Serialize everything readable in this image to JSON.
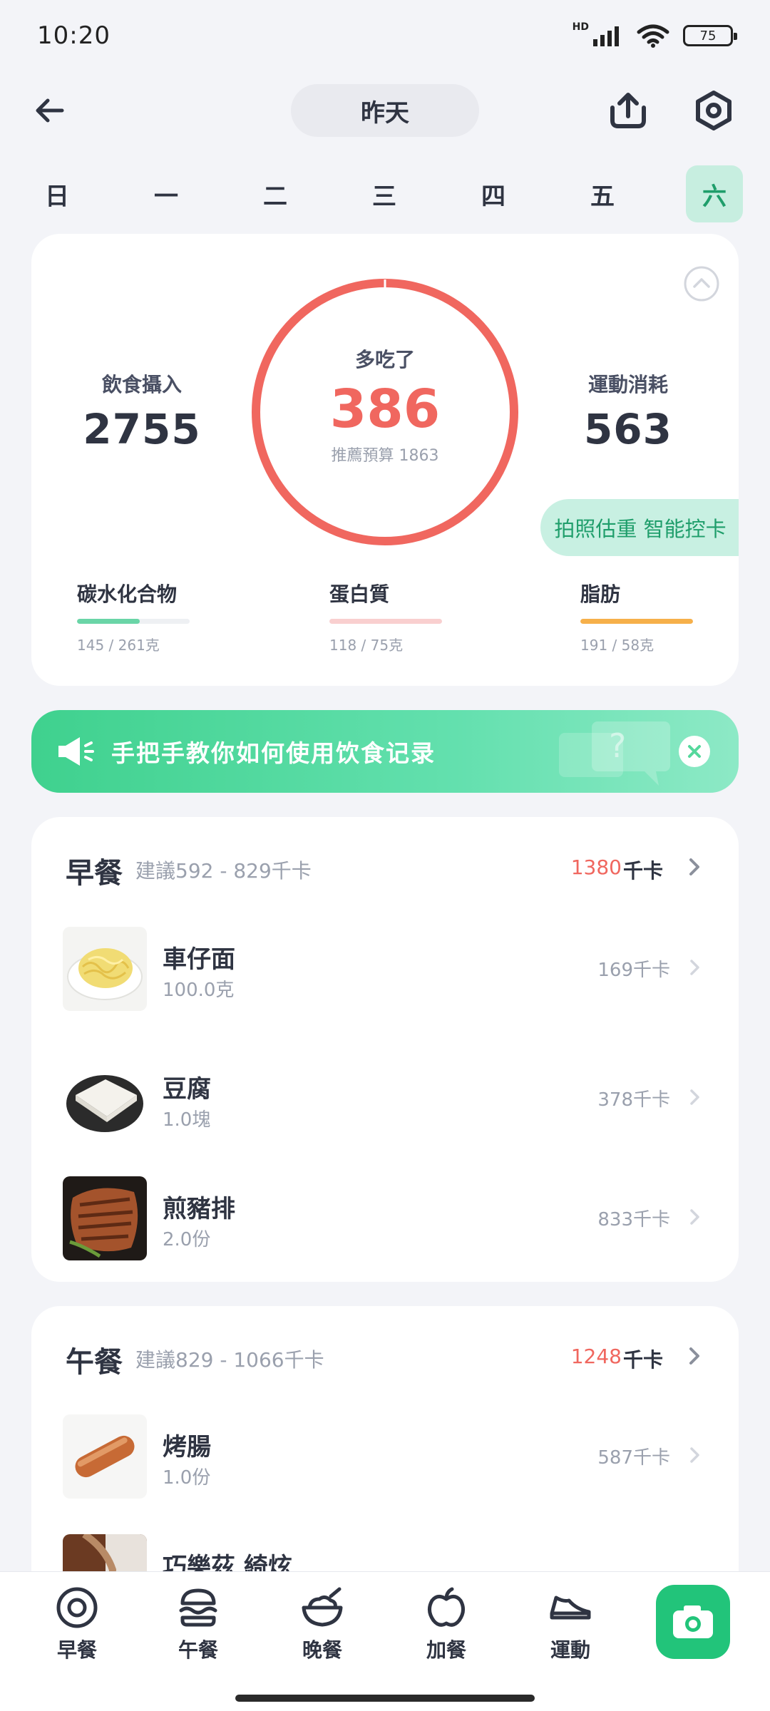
{
  "status_bar": {
    "time": "10:20",
    "network": "HD",
    "battery": "75"
  },
  "header": {
    "date_label": "昨天"
  },
  "weekdays": {
    "labels": [
      "日",
      "一",
      "二",
      "三",
      "四",
      "五",
      "六"
    ],
    "active_index": 6
  },
  "summary": {
    "intake_label": "飲食攝入",
    "intake_value": "2755",
    "ring_label": "多吃了",
    "ring_value": "386",
    "ring_sub": "推薦預算 1863",
    "burn_label": "運動消耗",
    "burn_value": "563",
    "promo": "拍照估重 智能控卡",
    "macros": [
      {
        "label": "碳水化合物",
        "detail": "145 / 261克",
        "progress": 0.56,
        "color": "#6ad5a7"
      },
      {
        "label": "蛋白質",
        "detail": "118 / 75克",
        "progress": 1.0,
        "color": "#f9cfcf"
      },
      {
        "label": "脂肪",
        "detail": "191 / 58克",
        "progress": 1.0,
        "color": "#f6b04a"
      }
    ]
  },
  "banner": {
    "text": "手把手教你如何使用饮食记录"
  },
  "meals": [
    {
      "title": "早餐",
      "suggest": "建議592 - 829千卡",
      "kcal": "1380",
      "unit": "千卡",
      "items": [
        {
          "name": "車仔面",
          "qty": "100.0克",
          "kcal": "169千卡"
        },
        {
          "name": "豆腐",
          "qty": "1.0塊",
          "kcal": "378千卡"
        },
        {
          "name": "煎豬排",
          "qty": "2.0份",
          "kcal": "833千卡"
        }
      ]
    },
    {
      "title": "午餐",
      "suggest": "建議829 - 1066千卡",
      "kcal": "1248",
      "unit": "千卡",
      "items": [
        {
          "name": "烤腸",
          "qty": "1.0份",
          "kcal": "587千卡"
        },
        {
          "name": "巧樂茲 綺炫",
          "qty": "",
          "kcal": ""
        }
      ]
    }
  ],
  "bottom_nav": {
    "items": [
      {
        "label": "早餐",
        "icon": "plate-icon"
      },
      {
        "label": "午餐",
        "icon": "burger-icon"
      },
      {
        "label": "晚餐",
        "icon": "bowl-icon"
      },
      {
        "label": "加餐",
        "icon": "apple-icon"
      },
      {
        "label": "運動",
        "icon": "shoe-icon"
      }
    ],
    "camera_icon": "camera-icon"
  }
}
